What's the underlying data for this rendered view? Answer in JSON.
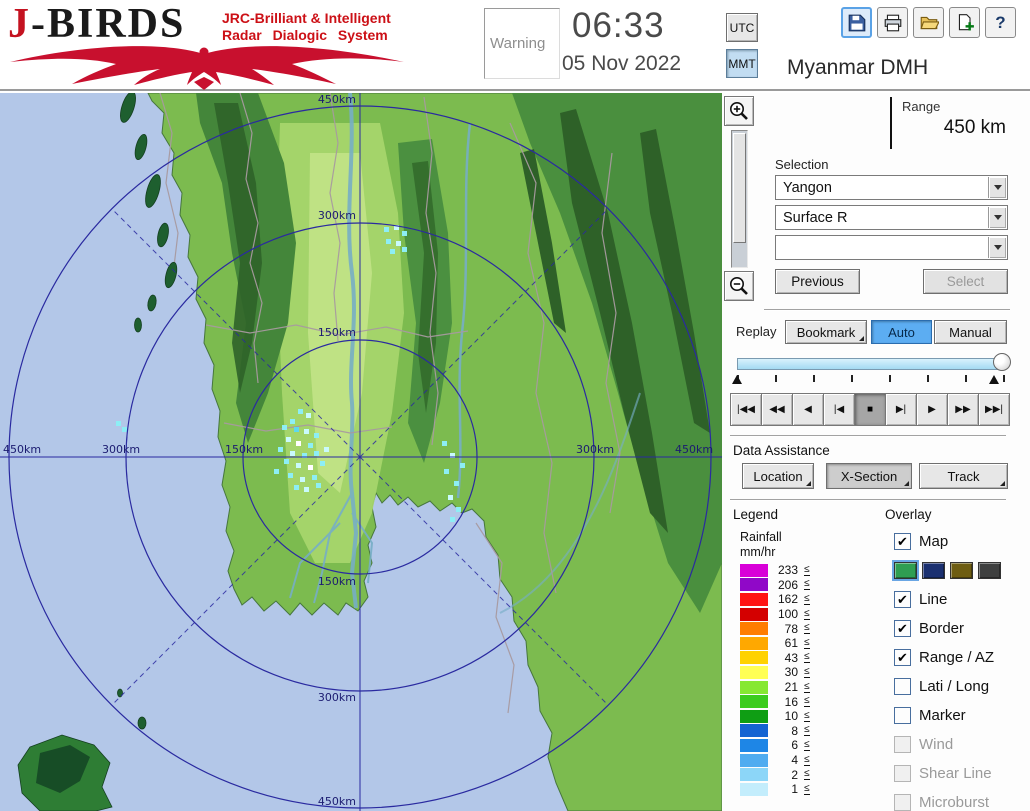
{
  "header": {
    "logo_j": "J",
    "logo_rest": "-BIRDS",
    "subtitle1": "JRC-Brilliant & Intelligent",
    "subtitle2": "Radar Dialogic System",
    "warning": "Warning",
    "time": "06:33",
    "date": "05 Nov 2022",
    "utc": "UTC",
    "mmt": "MMT",
    "station": "Myanmar DMH",
    "help_glyph": "?"
  },
  "range_panel": {
    "label": "Range",
    "value": "450 km"
  },
  "selection": {
    "label": "Selection",
    "site": "Yangon",
    "product": "Surface R",
    "extra": "",
    "previous": "Previous",
    "select": "Select"
  },
  "replay": {
    "label": "Replay",
    "bookmark": "Bookmark",
    "auto": "Auto",
    "manual": "Manual",
    "playback": [
      "|◀◀",
      "◀◀",
      "◀",
      "|◀",
      "■",
      "▶|",
      "▶",
      "▶▶",
      "▶▶|"
    ],
    "pressed_index": 4
  },
  "data_assistance": {
    "label": "Data Assistance",
    "location": "Location",
    "xsection": "X-Section",
    "track": "Track"
  },
  "legend": {
    "label": "Legend",
    "unit_line1": "Rainfall",
    "unit_line2": "mm/hr",
    "le_symbol": "≤",
    "entries": [
      {
        "value": "233",
        "color": "#d800d8"
      },
      {
        "value": "206",
        "color": "#9008c8"
      },
      {
        "value": "162",
        "color": "#ff1414"
      },
      {
        "value": "100",
        "color": "#d40000"
      },
      {
        "value": "78",
        "color": "#ff7d00"
      },
      {
        "value": "61",
        "color": "#ffa800"
      },
      {
        "value": "43",
        "color": "#ffd200"
      },
      {
        "value": "30",
        "color": "#ffff55"
      },
      {
        "value": "21",
        "color": "#86e832"
      },
      {
        "value": "16",
        "color": "#3ccc1e"
      },
      {
        "value": "10",
        "color": "#0f9e14"
      },
      {
        "value": "8",
        "color": "#1464d2"
      },
      {
        "value": "6",
        "color": "#1e86e6"
      },
      {
        "value": "4",
        "color": "#50acf0"
      },
      {
        "value": "2",
        "color": "#8cd6f8"
      },
      {
        "value": "1",
        "color": "#c3edfc"
      }
    ]
  },
  "overlay": {
    "label": "Overlay",
    "check_glyph": "✔",
    "map_swatches": [
      "#2f9e52",
      "#1b3070",
      "#6e5d12",
      "#3f4040"
    ],
    "items": [
      {
        "label": "Map",
        "checked": true,
        "enabled": true
      },
      {
        "label": "Line",
        "checked": true,
        "enabled": true
      },
      {
        "label": "Border",
        "checked": true,
        "enabled": true
      },
      {
        "label": "Range / AZ",
        "checked": true,
        "enabled": true
      },
      {
        "label": "Lati / Long",
        "checked": false,
        "enabled": true
      },
      {
        "label": "Marker",
        "checked": false,
        "enabled": true
      },
      {
        "label": "Wind",
        "checked": false,
        "enabled": false
      },
      {
        "label": "Shear Line",
        "checked": false,
        "enabled": false
      },
      {
        "label": "Microburst",
        "checked": false,
        "enabled": false
      }
    ]
  },
  "map": {
    "ring_labels": {
      "top": [
        "450km",
        "300km",
        "150km"
      ],
      "bottom": [
        "150km",
        "300km",
        "450km"
      ],
      "left": [
        "450km",
        "300km",
        "150km"
      ],
      "right": [
        "300km",
        "450km"
      ]
    }
  }
}
